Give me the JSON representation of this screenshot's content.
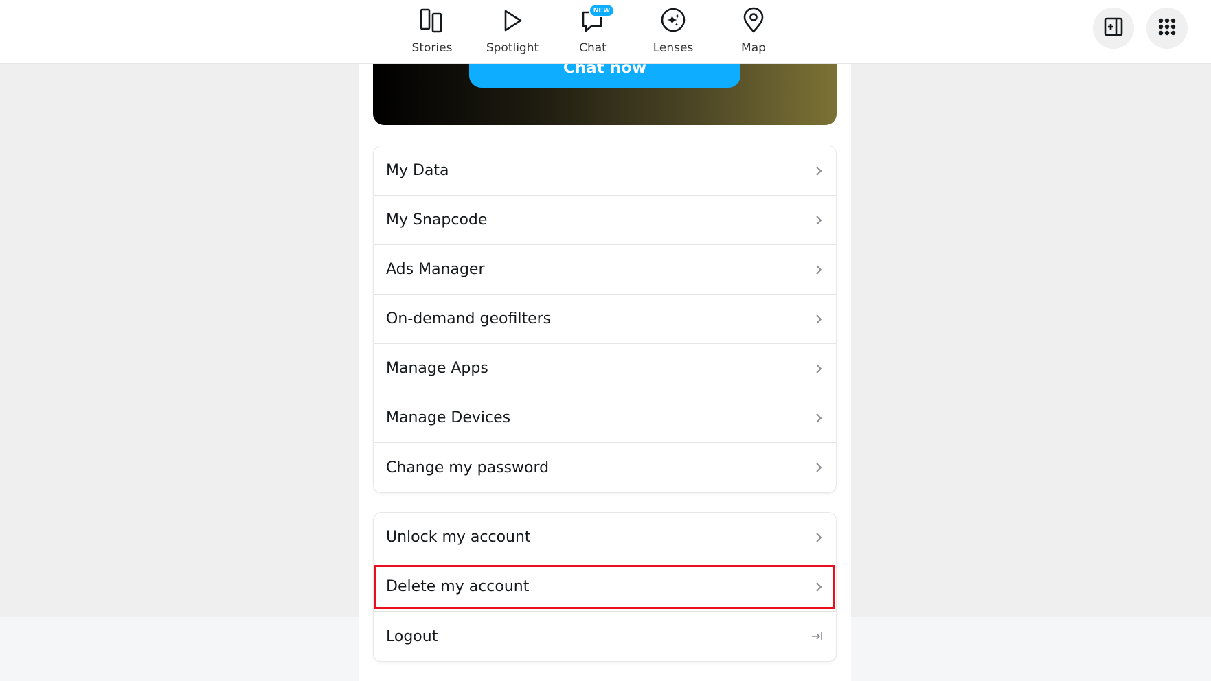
{
  "nav": {
    "items": [
      {
        "label": "Stories",
        "icon": "stories-icon"
      },
      {
        "label": "Spotlight",
        "icon": "spotlight-icon"
      },
      {
        "label": "Chat",
        "icon": "chat-icon",
        "badge": "NEW"
      },
      {
        "label": "Lenses",
        "icon": "lenses-icon"
      },
      {
        "label": "Map",
        "icon": "map-icon"
      }
    ],
    "right_buttons": [
      {
        "icon": "add-panel-icon"
      },
      {
        "icon": "apps-grid-icon"
      }
    ]
  },
  "promo": {
    "button_label": "Chat now"
  },
  "settings_group_1": [
    {
      "label": "My Data"
    },
    {
      "label": "My Snapcode"
    },
    {
      "label": "Ads Manager"
    },
    {
      "label": "On-demand geofilters"
    },
    {
      "label": "Manage Apps"
    },
    {
      "label": "Manage Devices"
    },
    {
      "label": "Change my password"
    }
  ],
  "settings_group_2": [
    {
      "label": "Unlock my account",
      "icon": "chevron-right-icon"
    },
    {
      "label": "Delete my account",
      "icon": "chevron-right-icon",
      "highlighted": true
    },
    {
      "label": "Logout",
      "icon": "logout-icon"
    }
  ],
  "colors": {
    "accent": "#0fadff",
    "highlight": "#e8101e"
  }
}
